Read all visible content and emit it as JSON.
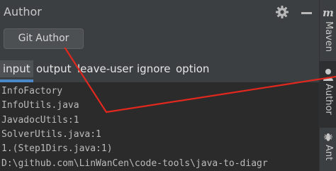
{
  "panel": {
    "title": "Author",
    "settings_icon": "gear-icon",
    "minimize_icon": "minimize-icon"
  },
  "toolbar": {
    "git_author_label": "Git Author"
  },
  "tabs": [
    {
      "label": "input",
      "active": true
    },
    {
      "label": "output",
      "active": false
    },
    {
      "label": "leave-user",
      "active": false
    },
    {
      "label": "ignore",
      "active": false
    },
    {
      "label": "option",
      "active": false
    }
  ],
  "output_lines": [
    "InfoFactory",
    "InfoUtils.java",
    "JavadocUtils:1",
    "SolverUtils.java:1",
    "1.(Step1Dirs.java:1)",
    "D:\\github.com\\LinWanCen\\code-tools\\java-to-diagr"
  ],
  "side_stripe": {
    "maven_label": "Maven",
    "maven_icon": "maven-m-icon",
    "author_label": "Author",
    "author_icon": "person-icon",
    "ant_label": "Ant",
    "ant_icon": "ant-icon"
  },
  "colors": {
    "panel_bg": "#3c3f41",
    "output_bg": "#2b2b2b",
    "text": "#bbbbbb",
    "accent": "#4a88c7",
    "annotation": "#e0281e"
  }
}
